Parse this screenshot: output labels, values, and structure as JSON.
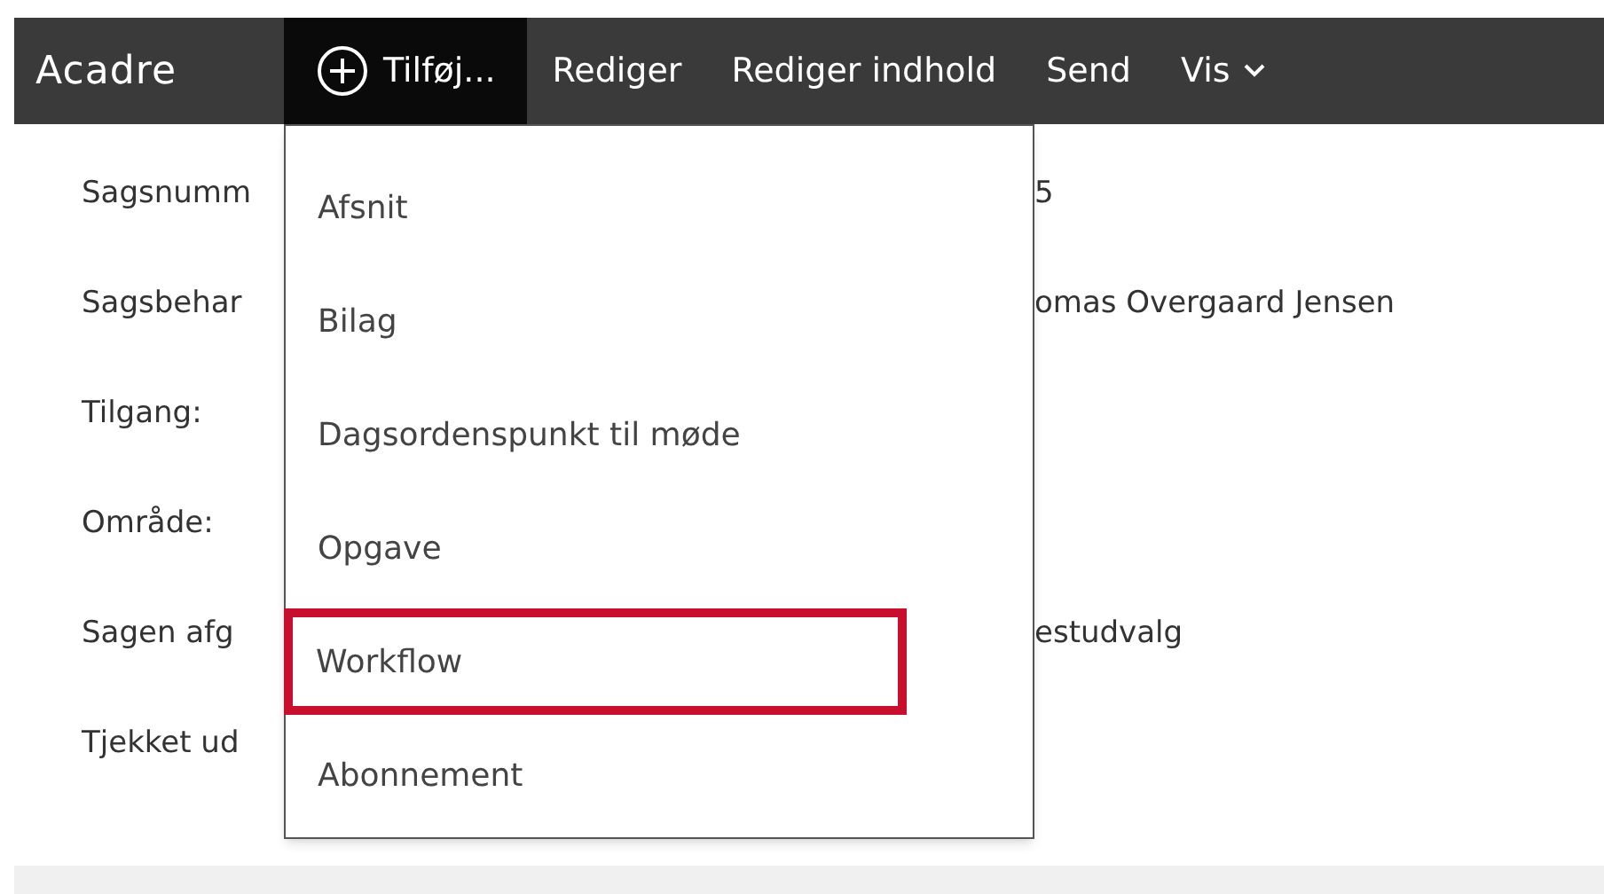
{
  "navbar": {
    "brand": "Acadre",
    "items": [
      {
        "label": "Tilføj...",
        "selected": true,
        "kind": "add"
      },
      {
        "label": "Rediger",
        "selected": false,
        "kind": "plain"
      },
      {
        "label": "Rediger indhold",
        "selected": false,
        "kind": "plain"
      },
      {
        "label": "Send",
        "selected": false,
        "kind": "plain"
      },
      {
        "label": "Vis",
        "selected": false,
        "kind": "dropdown"
      }
    ]
  },
  "fields": [
    {
      "label": "Sagsnumm",
      "value": "5"
    },
    {
      "label": "Sagsbehar",
      "value": "omas Overgaard Jensen"
    },
    {
      "label": "Tilgang:"
    },
    {
      "label": "Område:"
    },
    {
      "label": "Sagen afg",
      "value": "estudvalg"
    },
    {
      "label": "Tjekket ud"
    }
  ],
  "menu": {
    "items": [
      {
        "label": "Afsnit",
        "highlighted": false
      },
      {
        "label": "Bilag",
        "highlighted": false
      },
      {
        "label": "Dagsordenspunkt til møde",
        "highlighted": false
      },
      {
        "label": "Opgave",
        "highlighted": false
      },
      {
        "label": "Workflow",
        "highlighted": true
      },
      {
        "label": "Abonnement",
        "highlighted": false
      }
    ]
  }
}
